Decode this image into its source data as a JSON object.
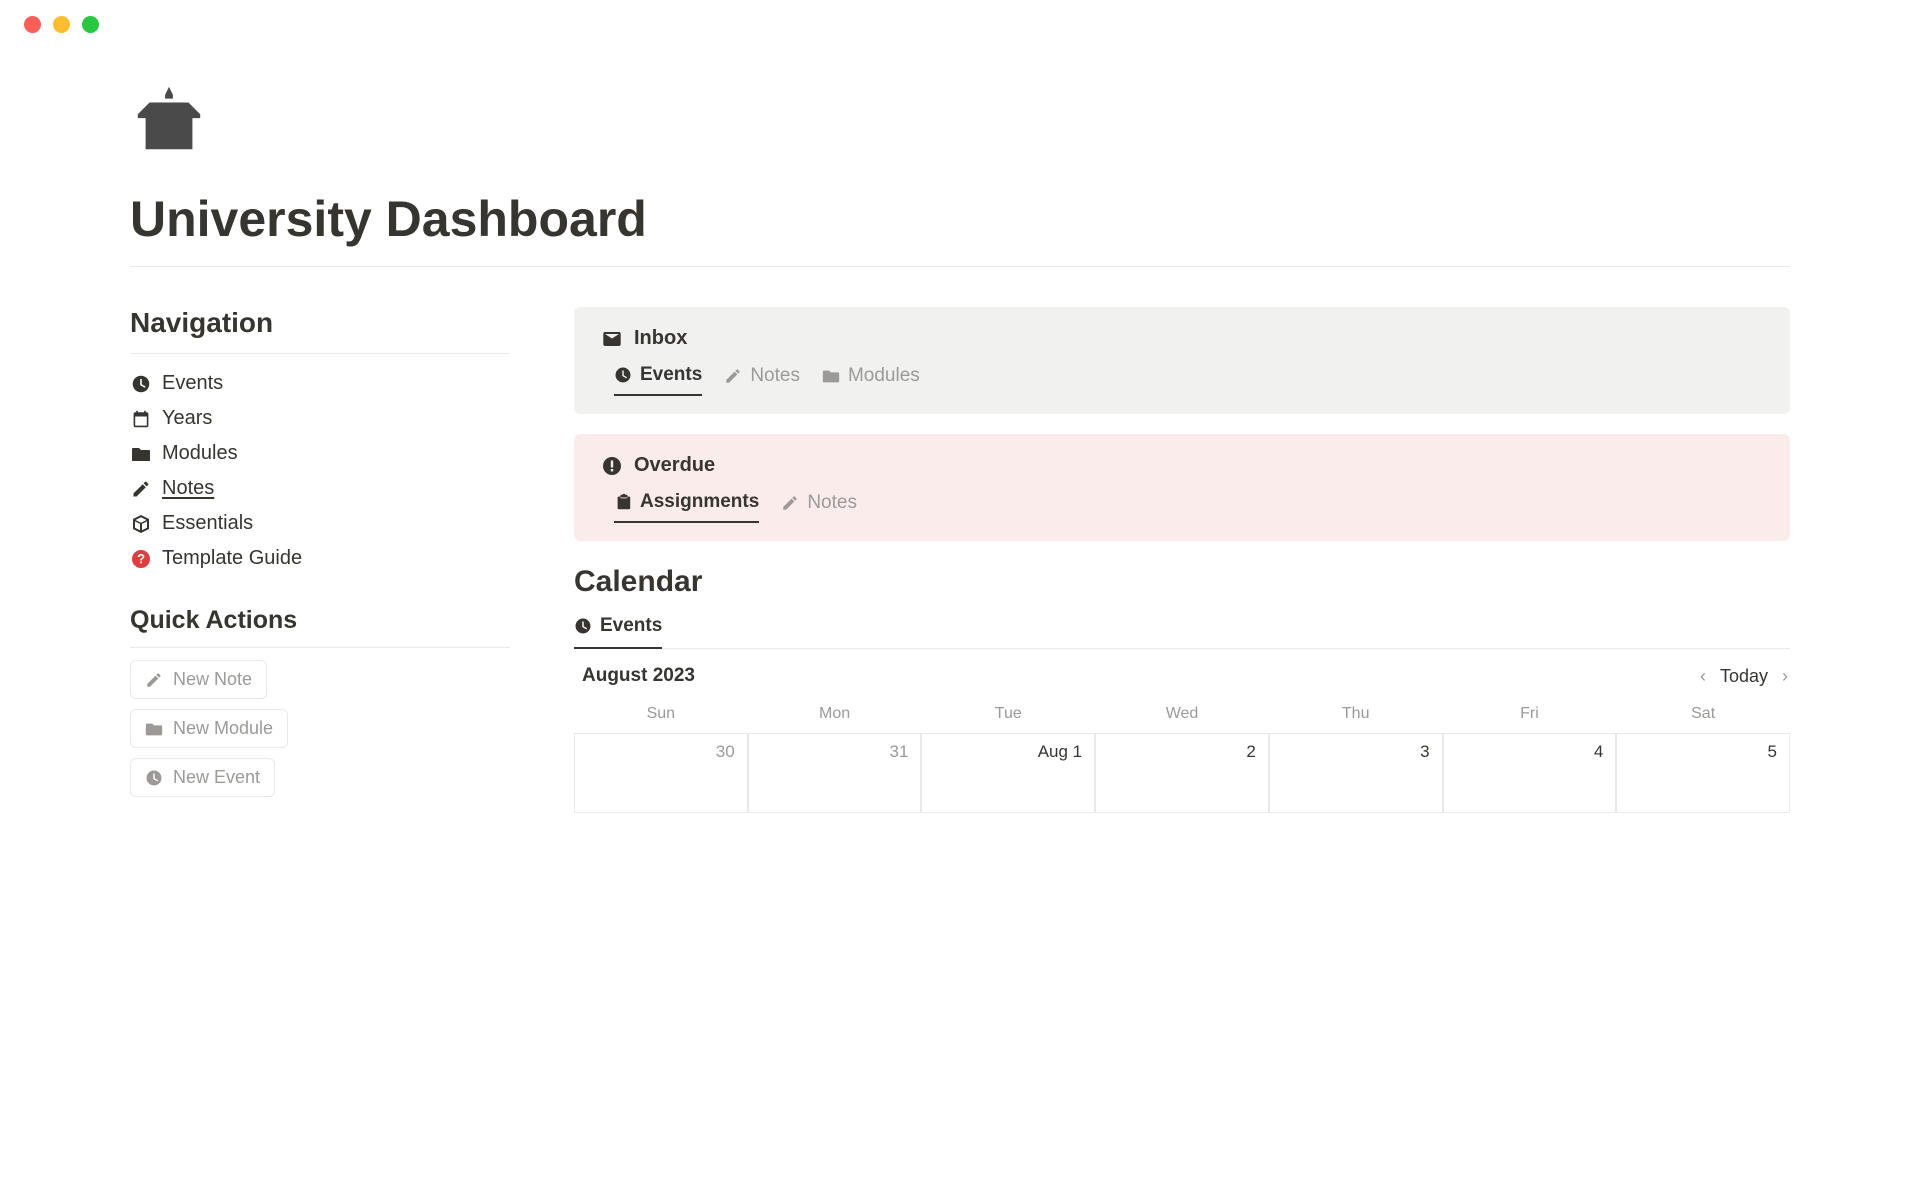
{
  "page": {
    "title": "University Dashboard"
  },
  "sidebar": {
    "navigation_heading": "Navigation",
    "items": [
      {
        "label": "Events",
        "icon": "clock-icon"
      },
      {
        "label": "Years",
        "icon": "calendar-icon"
      },
      {
        "label": "Modules",
        "icon": "folder-icon"
      },
      {
        "label": "Notes",
        "icon": "pencil-icon",
        "underline": true
      },
      {
        "label": "Essentials",
        "icon": "box-icon"
      },
      {
        "label": "Template Guide",
        "icon": "help-icon"
      }
    ],
    "quick_actions_heading": "Quick Actions",
    "quick_actions": [
      {
        "label": "New Note",
        "icon": "pencil-icon"
      },
      {
        "label": "New Module",
        "icon": "folder-icon"
      },
      {
        "label": "New Event",
        "icon": "clock-icon"
      }
    ]
  },
  "inbox": {
    "title": "Inbox",
    "tabs": [
      {
        "label": "Events",
        "icon": "clock-icon",
        "active": true
      },
      {
        "label": "Notes",
        "icon": "pencil-icon",
        "active": false
      },
      {
        "label": "Modules",
        "icon": "folder-icon",
        "active": false
      }
    ]
  },
  "overdue": {
    "title": "Overdue",
    "tabs": [
      {
        "label": "Assignments",
        "icon": "clipboard-icon",
        "active": true
      },
      {
        "label": "Notes",
        "icon": "pencil-icon",
        "active": false
      }
    ]
  },
  "calendar": {
    "heading": "Calendar",
    "tab_label": "Events",
    "month_label": "August 2023",
    "today_label": "Today",
    "day_headers": [
      "Sun",
      "Mon",
      "Tue",
      "Wed",
      "Thu",
      "Fri",
      "Sat"
    ],
    "cells": [
      {
        "label": "30",
        "other": true
      },
      {
        "label": "31",
        "other": true
      },
      {
        "label": "Aug 1",
        "other": false
      },
      {
        "label": "2",
        "other": false
      },
      {
        "label": "3",
        "other": false
      },
      {
        "label": "4",
        "other": false
      },
      {
        "label": "5",
        "other": false
      }
    ]
  }
}
